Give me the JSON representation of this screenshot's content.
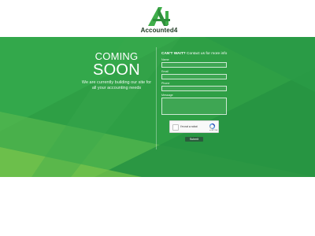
{
  "brand": {
    "name": "Accounted4",
    "logo_mark": "A4",
    "colors": {
      "primary": "#2e9f45",
      "dark": "#1e3a23"
    }
  },
  "hero": {
    "line1": "COMING",
    "line2": "SOON",
    "description": "We are currently building our site for all your accounting needs"
  },
  "form": {
    "heading_bold": "CAN'T WAIT?",
    "heading_rest": " Contact us for more info",
    "fields": [
      {
        "label": "Name"
      },
      {
        "label": "Email"
      },
      {
        "label": "Phone"
      },
      {
        "label": "Message"
      }
    ],
    "recaptcha_label": "I'm not a robot",
    "recaptcha_brand": "reCAPTCHA",
    "submit_label": "Submit"
  }
}
